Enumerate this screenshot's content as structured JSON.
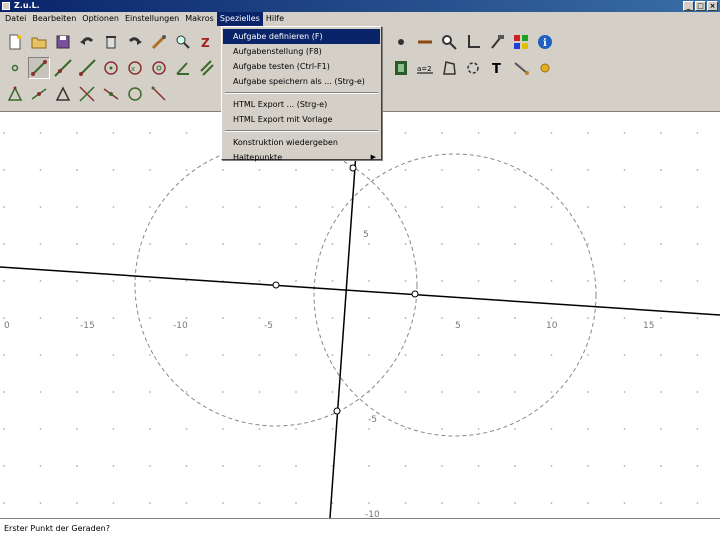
{
  "window": {
    "title": "Z.u.L.",
    "buttons": [
      "_",
      "□",
      "×"
    ]
  },
  "menubar": {
    "items": [
      {
        "label": "Datei"
      },
      {
        "label": "Bearbeiten"
      },
      {
        "label": "Optionen"
      },
      {
        "label": "Einstellungen"
      },
      {
        "label": "Makros"
      },
      {
        "label": "Spezielles",
        "active": true
      },
      {
        "label": "Hilfe"
      }
    ]
  },
  "dropdown": {
    "items": [
      {
        "label": "Aufgabe definieren (F)",
        "highlighted": true
      },
      {
        "label": "Aufgabenstellung    (F8)"
      },
      {
        "label": "Aufgabe testen (Ctrl-F1)"
      },
      {
        "label": "Aufgabe speichern als ... (Strg-e)"
      },
      {
        "label": "HTML Export ...  (Strg-e)"
      },
      {
        "label": "HTML Export mit Vorlage"
      },
      {
        "label": "Konstruktion wiedergeben"
      },
      {
        "label": "Haltepunkte",
        "submenu": true
      }
    ]
  },
  "toolbar": {
    "row1": [
      "new-file-icon",
      "open-folder-icon",
      "save-disk-icon",
      "undo-icon",
      "delete-icon",
      "redo-icon",
      "edit-tool-icon",
      "zoom-tool-icon",
      "text-tool-icon",
      "point-style-icon",
      "line-style-icon",
      "zoom-in-icon",
      "axes-icon",
      "hammer-icon",
      "color-grid-icon",
      "info-icon"
    ],
    "row2": [
      "point-icon",
      "segment-icon",
      "line-icon",
      "ray-icon",
      "circle-icon",
      "circle-three-icon",
      "circle-fixed-icon",
      "angle-icon",
      "parallel-icon",
      "film-icon",
      "expression-icon",
      "polygon-icon",
      "arc-icon",
      "text-t-icon",
      "tool-icon",
      "sun-icon"
    ],
    "row3": [
      "triangle-icon",
      "midpoint-icon",
      "perpendicular-icon",
      "intersection-icon",
      "compass-icon",
      "circle-tool-icon",
      "macro-icon"
    ]
  },
  "canvas": {
    "x_ticks": [
      "0",
      "-15",
      "-10",
      "-5",
      "5",
      "10",
      "15"
    ],
    "y_ticks": [
      "5",
      "-5",
      "-10"
    ]
  },
  "status": {
    "text": "Erster Punkt der Geraden?"
  }
}
